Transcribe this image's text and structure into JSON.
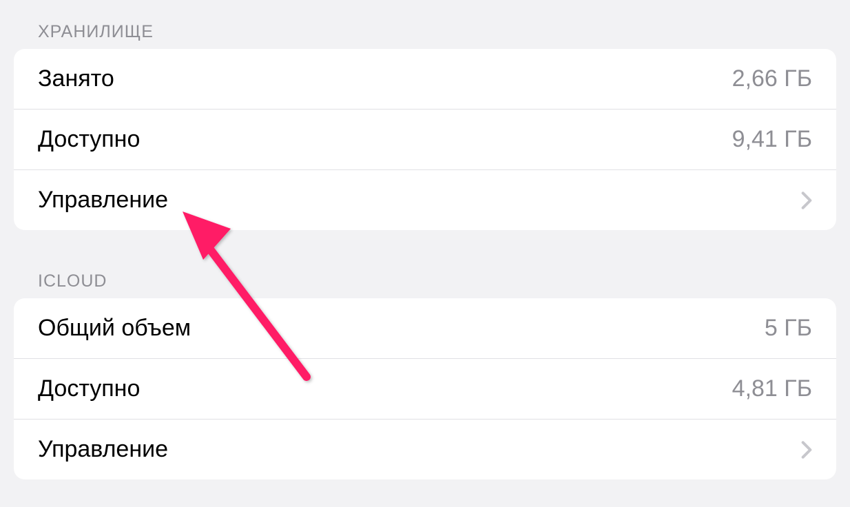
{
  "storage": {
    "header": "ХРАНИЛИЩЕ",
    "rows": [
      {
        "label": "Занято",
        "value": "2,66 ГБ",
        "navigable": false
      },
      {
        "label": "Доступно",
        "value": "9,41 ГБ",
        "navigable": false
      },
      {
        "label": "Управление",
        "value": "",
        "navigable": true
      }
    ]
  },
  "icloud": {
    "header": "ICLOUD",
    "rows": [
      {
        "label": "Общий объем",
        "value": "5 ГБ",
        "navigable": false
      },
      {
        "label": "Доступно",
        "value": "4,81 ГБ",
        "navigable": false
      },
      {
        "label": "Управление",
        "value": "",
        "navigable": true
      }
    ]
  },
  "annotation": {
    "color": "#ff1a66"
  }
}
